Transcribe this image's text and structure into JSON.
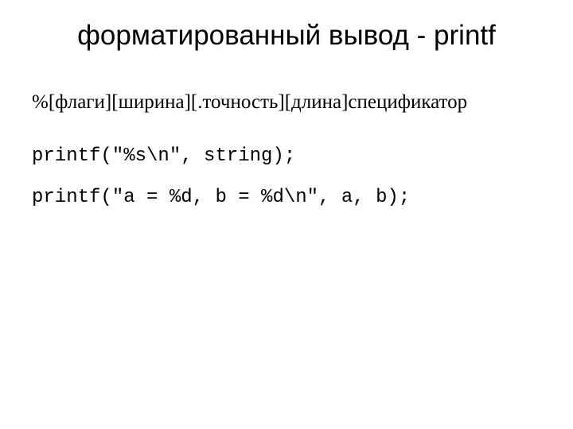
{
  "title": "форматированный вывод - printf",
  "formatSpec": "%[флаги][ширина][.точность][длина]спецификатор",
  "codeLines": [
    "printf(\"%s\\n\", string);",
    "printf(\"a = %d, b = %d\\n\", a, b);"
  ]
}
